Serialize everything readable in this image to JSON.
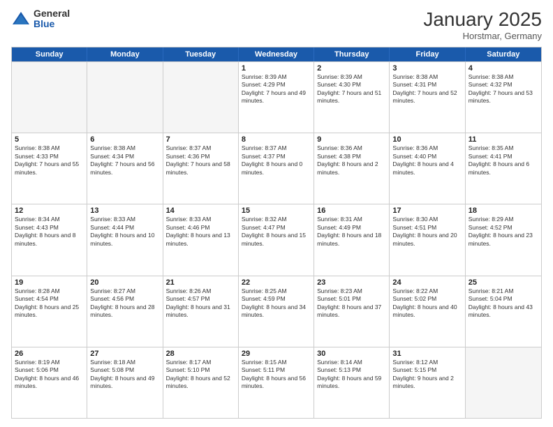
{
  "logo": {
    "general": "General",
    "blue": "Blue"
  },
  "title": "January 2025",
  "subtitle": "Horstmar, Germany",
  "days": [
    "Sunday",
    "Monday",
    "Tuesday",
    "Wednesday",
    "Thursday",
    "Friday",
    "Saturday"
  ],
  "weeks": [
    [
      {
        "day": "",
        "sunrise": "",
        "sunset": "",
        "daylight": ""
      },
      {
        "day": "",
        "sunrise": "",
        "sunset": "",
        "daylight": ""
      },
      {
        "day": "",
        "sunrise": "",
        "sunset": "",
        "daylight": ""
      },
      {
        "day": "1",
        "sunrise": "Sunrise: 8:39 AM",
        "sunset": "Sunset: 4:29 PM",
        "daylight": "Daylight: 7 hours and 49 minutes."
      },
      {
        "day": "2",
        "sunrise": "Sunrise: 8:39 AM",
        "sunset": "Sunset: 4:30 PM",
        "daylight": "Daylight: 7 hours and 51 minutes."
      },
      {
        "day": "3",
        "sunrise": "Sunrise: 8:38 AM",
        "sunset": "Sunset: 4:31 PM",
        "daylight": "Daylight: 7 hours and 52 minutes."
      },
      {
        "day": "4",
        "sunrise": "Sunrise: 8:38 AM",
        "sunset": "Sunset: 4:32 PM",
        "daylight": "Daylight: 7 hours and 53 minutes."
      }
    ],
    [
      {
        "day": "5",
        "sunrise": "Sunrise: 8:38 AM",
        "sunset": "Sunset: 4:33 PM",
        "daylight": "Daylight: 7 hours and 55 minutes."
      },
      {
        "day": "6",
        "sunrise": "Sunrise: 8:38 AM",
        "sunset": "Sunset: 4:34 PM",
        "daylight": "Daylight: 7 hours and 56 minutes."
      },
      {
        "day": "7",
        "sunrise": "Sunrise: 8:37 AM",
        "sunset": "Sunset: 4:36 PM",
        "daylight": "Daylight: 7 hours and 58 minutes."
      },
      {
        "day": "8",
        "sunrise": "Sunrise: 8:37 AM",
        "sunset": "Sunset: 4:37 PM",
        "daylight": "Daylight: 8 hours and 0 minutes."
      },
      {
        "day": "9",
        "sunrise": "Sunrise: 8:36 AM",
        "sunset": "Sunset: 4:38 PM",
        "daylight": "Daylight: 8 hours and 2 minutes."
      },
      {
        "day": "10",
        "sunrise": "Sunrise: 8:36 AM",
        "sunset": "Sunset: 4:40 PM",
        "daylight": "Daylight: 8 hours and 4 minutes."
      },
      {
        "day": "11",
        "sunrise": "Sunrise: 8:35 AM",
        "sunset": "Sunset: 4:41 PM",
        "daylight": "Daylight: 8 hours and 6 minutes."
      }
    ],
    [
      {
        "day": "12",
        "sunrise": "Sunrise: 8:34 AM",
        "sunset": "Sunset: 4:43 PM",
        "daylight": "Daylight: 8 hours and 8 minutes."
      },
      {
        "day": "13",
        "sunrise": "Sunrise: 8:33 AM",
        "sunset": "Sunset: 4:44 PM",
        "daylight": "Daylight: 8 hours and 10 minutes."
      },
      {
        "day": "14",
        "sunrise": "Sunrise: 8:33 AM",
        "sunset": "Sunset: 4:46 PM",
        "daylight": "Daylight: 8 hours and 13 minutes."
      },
      {
        "day": "15",
        "sunrise": "Sunrise: 8:32 AM",
        "sunset": "Sunset: 4:47 PM",
        "daylight": "Daylight: 8 hours and 15 minutes."
      },
      {
        "day": "16",
        "sunrise": "Sunrise: 8:31 AM",
        "sunset": "Sunset: 4:49 PM",
        "daylight": "Daylight: 8 hours and 18 minutes."
      },
      {
        "day": "17",
        "sunrise": "Sunrise: 8:30 AM",
        "sunset": "Sunset: 4:51 PM",
        "daylight": "Daylight: 8 hours and 20 minutes."
      },
      {
        "day": "18",
        "sunrise": "Sunrise: 8:29 AM",
        "sunset": "Sunset: 4:52 PM",
        "daylight": "Daylight: 8 hours and 23 minutes."
      }
    ],
    [
      {
        "day": "19",
        "sunrise": "Sunrise: 8:28 AM",
        "sunset": "Sunset: 4:54 PM",
        "daylight": "Daylight: 8 hours and 25 minutes."
      },
      {
        "day": "20",
        "sunrise": "Sunrise: 8:27 AM",
        "sunset": "Sunset: 4:56 PM",
        "daylight": "Daylight: 8 hours and 28 minutes."
      },
      {
        "day": "21",
        "sunrise": "Sunrise: 8:26 AM",
        "sunset": "Sunset: 4:57 PM",
        "daylight": "Daylight: 8 hours and 31 minutes."
      },
      {
        "day": "22",
        "sunrise": "Sunrise: 8:25 AM",
        "sunset": "Sunset: 4:59 PM",
        "daylight": "Daylight: 8 hours and 34 minutes."
      },
      {
        "day": "23",
        "sunrise": "Sunrise: 8:23 AM",
        "sunset": "Sunset: 5:01 PM",
        "daylight": "Daylight: 8 hours and 37 minutes."
      },
      {
        "day": "24",
        "sunrise": "Sunrise: 8:22 AM",
        "sunset": "Sunset: 5:02 PM",
        "daylight": "Daylight: 8 hours and 40 minutes."
      },
      {
        "day": "25",
        "sunrise": "Sunrise: 8:21 AM",
        "sunset": "Sunset: 5:04 PM",
        "daylight": "Daylight: 8 hours and 43 minutes."
      }
    ],
    [
      {
        "day": "26",
        "sunrise": "Sunrise: 8:19 AM",
        "sunset": "Sunset: 5:06 PM",
        "daylight": "Daylight: 8 hours and 46 minutes."
      },
      {
        "day": "27",
        "sunrise": "Sunrise: 8:18 AM",
        "sunset": "Sunset: 5:08 PM",
        "daylight": "Daylight: 8 hours and 49 minutes."
      },
      {
        "day": "28",
        "sunrise": "Sunrise: 8:17 AM",
        "sunset": "Sunset: 5:10 PM",
        "daylight": "Daylight: 8 hours and 52 minutes."
      },
      {
        "day": "29",
        "sunrise": "Sunrise: 8:15 AM",
        "sunset": "Sunset: 5:11 PM",
        "daylight": "Daylight: 8 hours and 56 minutes."
      },
      {
        "day": "30",
        "sunrise": "Sunrise: 8:14 AM",
        "sunset": "Sunset: 5:13 PM",
        "daylight": "Daylight: 8 hours and 59 minutes."
      },
      {
        "day": "31",
        "sunrise": "Sunrise: 8:12 AM",
        "sunset": "Sunset: 5:15 PM",
        "daylight": "Daylight: 9 hours and 2 minutes."
      },
      {
        "day": "",
        "sunrise": "",
        "sunset": "",
        "daylight": ""
      }
    ]
  ]
}
